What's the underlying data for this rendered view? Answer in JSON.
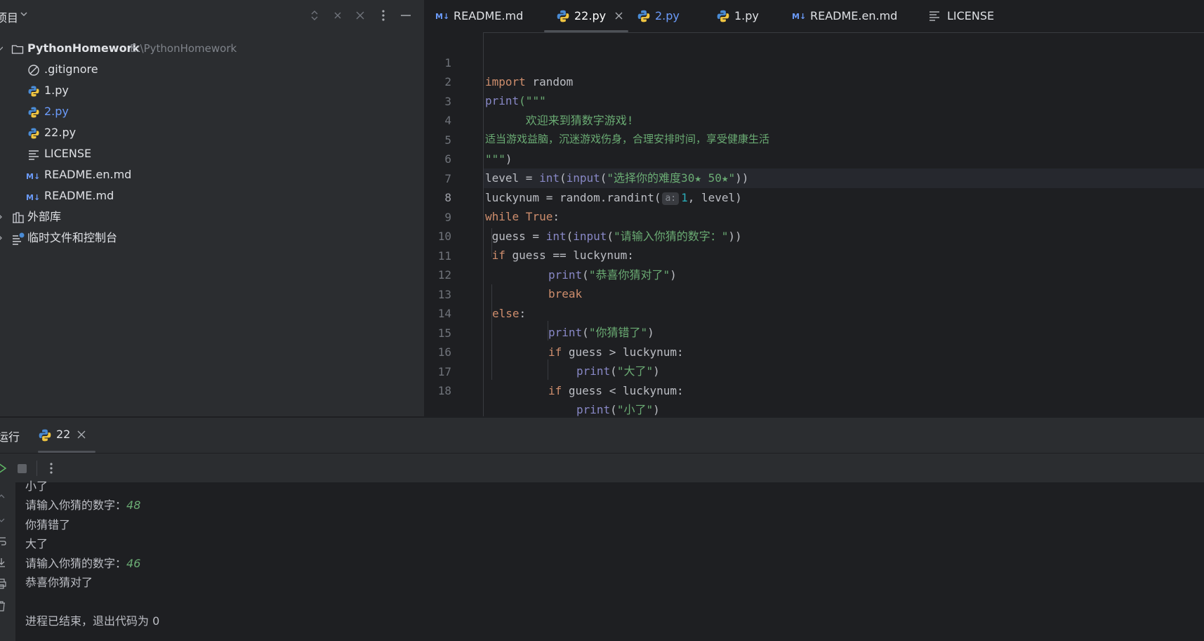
{
  "project": {
    "title": "项目",
    "root": {
      "name": "PythonHomework",
      "path": "E:\\PythonHomework"
    },
    "items": [
      {
        "label": ".gitignore",
        "icon": "ignored-file-icon"
      },
      {
        "label": "1.py",
        "icon": "python-file-icon"
      },
      {
        "label": "2.py",
        "icon": "python-file-icon",
        "modified": true
      },
      {
        "label": "22.py",
        "icon": "python-file-icon"
      },
      {
        "label": "LICENSE",
        "icon": "text-file-icon"
      },
      {
        "label": "README.en.md",
        "icon": "markdown-file-icon"
      },
      {
        "label": "README.md",
        "icon": "markdown-file-icon"
      }
    ],
    "external_libraries": "外部库",
    "scratches": "临时文件和控制台"
  },
  "tabs": [
    {
      "label": "README.md",
      "icon": "markdown-file-icon"
    },
    {
      "label": "22.py",
      "icon": "python-file-icon",
      "active": true
    },
    {
      "label": "2.py",
      "icon": "python-file-icon",
      "modified": true
    },
    {
      "label": "1.py",
      "icon": "python-file-icon"
    },
    {
      "label": "README.en.md",
      "icon": "markdown-file-icon"
    },
    {
      "label": "LICENSE",
      "icon": "text-file-icon"
    }
  ],
  "editor": {
    "current_line": 8,
    "line_numbers": [
      "1",
      "2",
      "3",
      "4",
      "5",
      "6",
      "7",
      "8",
      "9",
      "10",
      "11",
      "12",
      "13",
      "14",
      "15",
      "16",
      "17",
      "18"
    ],
    "tokens": {
      "import": "import",
      "random": " random",
      "print": "print",
      "open_triple": "(\"\"\"",
      "welcome": "      欢迎来到猜数字游戏!",
      "advice": "适当游戏益脑，沉迷游戏伤身，合理安排时间，享受健康生活",
      "close_triple": "\"\"\"",
      "close_paren": ")",
      "level_assign": "level = ",
      "int": "int",
      "open_paren": "(",
      "input": "input",
      "level_prompt": "\"选择你的难度30★ 50★\"",
      "close_parens2": "))",
      "luckynum_assign": "luckynum = random.randint(",
      "param_hint": "a:",
      "one": "1",
      "randint_rest": ", level)",
      "while": "while",
      "true": " True",
      "colon": ":",
      "guess_assign": " guess = ",
      "guess_prompt": "\"请输入你猜的数字：\"",
      "if": "if",
      "guess_eq": " guess == luckynum:",
      "congrats": "\"恭喜你猜对了\"",
      "break": "break",
      "else": "else",
      "wrong": "\"你猜错了\"",
      "guess_gt": " guess > luckynum:",
      "too_big": "\"大了\"",
      "guess_lt": " guess < luckynum:",
      "too_small": "\"小了\""
    }
  },
  "run": {
    "title": "运行",
    "tab_label": "22",
    "console": [
      {
        "text": "小了"
      },
      {
        "text": "请输入你猜的数字：",
        "input": "48"
      },
      {
        "text": "你猜错了"
      },
      {
        "text": "大了"
      },
      {
        "text": "请输入你猜的数字：",
        "input": "46"
      },
      {
        "text": "恭喜你猜对了"
      },
      {
        "text": ""
      },
      {
        "text": "进程已结束，退出代码为 0"
      }
    ]
  },
  "colors": {
    "keyword": "#cf8e6d",
    "builtin": "#8888c6",
    "string": "#6aab73",
    "number": "#2aacb8",
    "modified_file": "#6b9bfa"
  }
}
